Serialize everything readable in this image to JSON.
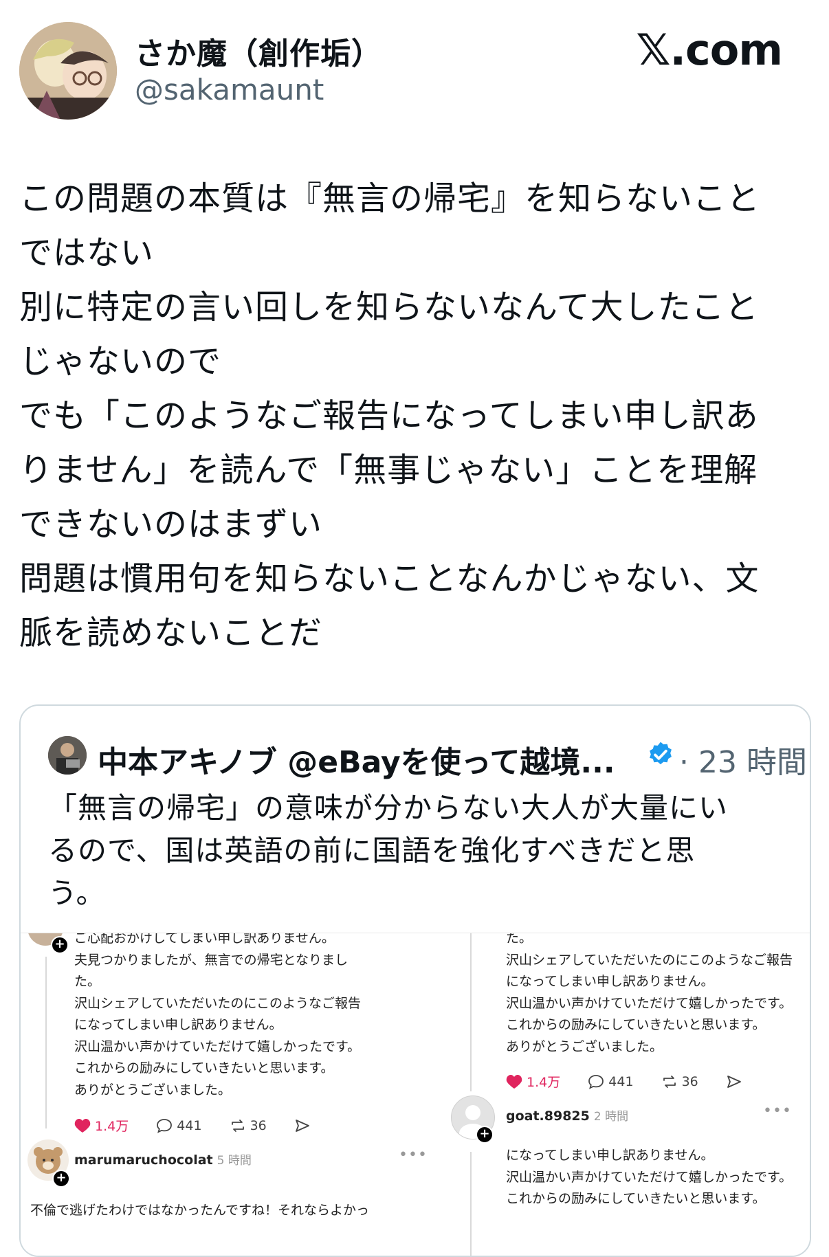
{
  "header": {
    "display_name": "さか魔（創作垢）",
    "handle": "@sakamaunt",
    "brand": "𝕏.com"
  },
  "tweet": {
    "lines": [
      "この問題の本質は『無言の帰宅』を知らないこと",
      "ではない",
      "別に特定の言い回しを知らないなんて大したこと",
      "じゃないので",
      "でも「このようなご報告になってしまい申し訳あ",
      "りません」を読んで「無事じゃない」ことを理解",
      "できないのはまずい",
      "問題は慣用句を知らないことなんかじゃない、文",
      "脈を読めないことだ"
    ]
  },
  "quote": {
    "name": "中本アキノブ @eBayを使って越境...",
    "time": "· 23 時間",
    "lines": [
      "「無言の帰宅」の意味が分からない大人が大量にい",
      "るので、国は英語の前に国語を強化すべきだと思",
      "う。"
    ]
  },
  "media": {
    "left": {
      "lines": [
        "ご心配おかけしてしまい申し訳ありません。",
        "夫見つかりましたが、無言での帰宅となりまし",
        "た。",
        "沢山シェアしていただいたのにこのようなご報告",
        "になってしまい申し訳ありません。",
        "沢山温かい声かけていただけて嬉しかったです。",
        "これからの励みにしていきたいと思います。",
        "ありがとうございました。"
      ],
      "actions": {
        "likes": "1.4万",
        "replies": "441",
        "reposts": "36"
      },
      "reply": {
        "user": "marumaruchocolat",
        "time": "5 時間",
        "text": "不倫で逃げたわけではなかったんですね！それならよかっ"
      }
    },
    "right": {
      "lines": [
        "た。",
        "沢山シェアしていただいたのにこのようなご報告",
        "になってしまい申し訳ありません。",
        "沢山温かい声かけていただけて嬉しかったです。",
        "これからの励みにしていきたいと思います。",
        "ありがとうございました。"
      ],
      "actions": {
        "likes": "1.4万",
        "replies": "441",
        "reposts": "36"
      },
      "reply": {
        "user": "goat.89825",
        "time": "2 時間",
        "lines": [
          "になってしまい申し訳ありません。",
          "沢山温かい声かけていただけて嬉しかったです。",
          "これからの励みにしていきたいと思います。"
        ]
      }
    }
  },
  "colors": {
    "text": "#0f1419",
    "secondary": "#536471",
    "verified": "#1d9bf0",
    "like": "#e0245e",
    "border": "#cfd9de"
  },
  "icons": [
    "heart-icon",
    "reply-icon",
    "repost-icon",
    "share-icon",
    "verified-badge-icon",
    "more-icon",
    "follow-plus-icon"
  ]
}
